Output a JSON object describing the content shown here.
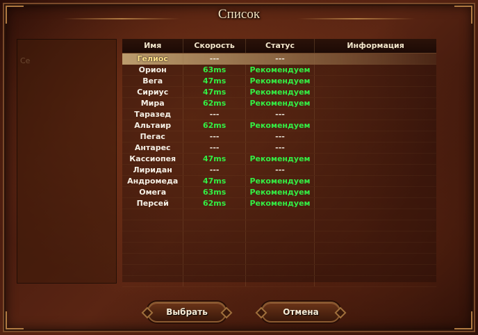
{
  "window": {
    "title": "Список"
  },
  "table": {
    "columns": [
      "Имя",
      "Скорость",
      "Статус",
      "Информация"
    ],
    "rows": [
      {
        "name": "Гелиос",
        "speed": "---",
        "status": "---",
        "info": "",
        "selected": true
      },
      {
        "name": "Орион",
        "speed": "63ms",
        "status": "Рекомендуем",
        "info": ""
      },
      {
        "name": "Вега",
        "speed": "47ms",
        "status": "Рекомендуем",
        "info": ""
      },
      {
        "name": "Сириус",
        "speed": "47ms",
        "status": "Рекомендуем",
        "info": ""
      },
      {
        "name": "Мира",
        "speed": "62ms",
        "status": "Рекомендуем",
        "info": ""
      },
      {
        "name": "Таразед",
        "speed": "---",
        "status": "---",
        "info": ""
      },
      {
        "name": "Альтаир",
        "speed": "62ms",
        "status": "Рекомендуем",
        "info": ""
      },
      {
        "name": "Пегас",
        "speed": "---",
        "status": "---",
        "info": ""
      },
      {
        "name": "Антарес",
        "speed": "---",
        "status": "---",
        "info": ""
      },
      {
        "name": "Кассиопея",
        "speed": "47ms",
        "status": "Рекомендуем",
        "info": ""
      },
      {
        "name": "Лиридан",
        "speed": "---",
        "status": "---",
        "info": ""
      },
      {
        "name": "Андромеда",
        "speed": "47ms",
        "status": "Рекомендуем",
        "info": ""
      },
      {
        "name": "Омега",
        "speed": "63ms",
        "status": "Рекомендуем",
        "info": ""
      },
      {
        "name": "Персей",
        "speed": "62ms",
        "status": "Рекомендуем",
        "info": ""
      }
    ]
  },
  "left_panel": {
    "ghost_text": "Се"
  },
  "buttons": {
    "select": "Выбрать",
    "cancel": "Отмена"
  },
  "colors": {
    "ok": "#33ee44",
    "selected_name": "#ffe08a",
    "text": "#f5f0e6"
  }
}
